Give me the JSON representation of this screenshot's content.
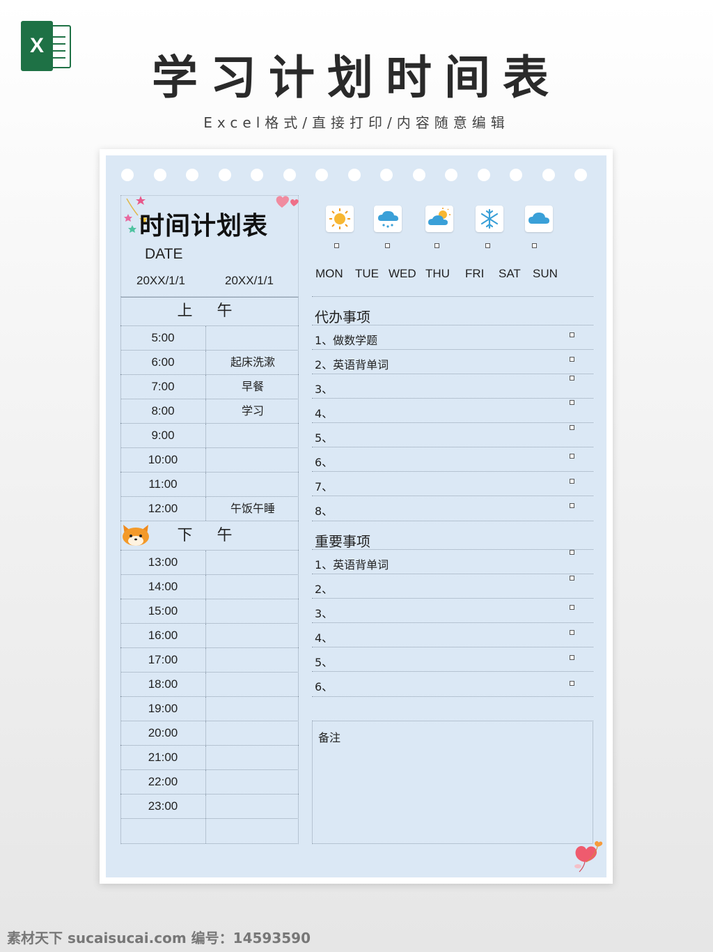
{
  "header": {
    "logo_letter": "X",
    "title": "学习计划时间表",
    "subtitle": "Excel格式/直接打印/内容随意编辑"
  },
  "sheet": {
    "title": "时间计划表",
    "date_label": "DATE",
    "date_start": "20XX/1/1",
    "date_end": "20XX/1/1"
  },
  "schedule": {
    "morning_label": "上 午",
    "afternoon_label": "下 午",
    "morning": [
      {
        "time": "5:00",
        "activity": ""
      },
      {
        "time": "6:00",
        "activity": "起床洗漱"
      },
      {
        "time": "7:00",
        "activity": "早餐"
      },
      {
        "time": "8:00",
        "activity": "学习"
      },
      {
        "time": "9:00",
        "activity": ""
      },
      {
        "time": "10:00",
        "activity": ""
      },
      {
        "time": "11:00",
        "activity": ""
      },
      {
        "time": "12:00",
        "activity": "午饭午睡"
      }
    ],
    "afternoon": [
      {
        "time": "13:00",
        "activity": ""
      },
      {
        "time": "14:00",
        "activity": ""
      },
      {
        "time": "15:00",
        "activity": ""
      },
      {
        "time": "16:00",
        "activity": ""
      },
      {
        "time": "17:00",
        "activity": ""
      },
      {
        "time": "18:00",
        "activity": ""
      },
      {
        "time": "19:00",
        "activity": ""
      },
      {
        "time": "20:00",
        "activity": ""
      },
      {
        "time": "21:00",
        "activity": ""
      },
      {
        "time": "22:00",
        "activity": ""
      },
      {
        "time": "23:00",
        "activity": ""
      },
      {
        "time": "",
        "activity": ""
      }
    ]
  },
  "weather": {
    "icons": [
      "sun-icon",
      "rain-cloud-icon",
      "partly-cloudy-icon",
      "snowflake-icon",
      "cloud-icon"
    ],
    "days": [
      "MON",
      "TUE",
      "WED",
      "THU",
      "FRI",
      "SAT",
      "SUN"
    ]
  },
  "todo": {
    "title": "代办事项",
    "items": [
      "1、做数学题",
      "2、英语背单词",
      "3、",
      "4、",
      "5、",
      "6、",
      "7、",
      "8、"
    ]
  },
  "important": {
    "title": "重要事项",
    "items": [
      "1、英语背单词",
      "2、",
      "3、",
      "4、",
      "5、",
      "6、"
    ]
  },
  "notes": {
    "label": "备注"
  },
  "watermark": "素材天下 sucaisucai.com  编号：14593590",
  "colors": {
    "paper_background": "#dbe8f5",
    "excel_green": "#1e7145"
  }
}
